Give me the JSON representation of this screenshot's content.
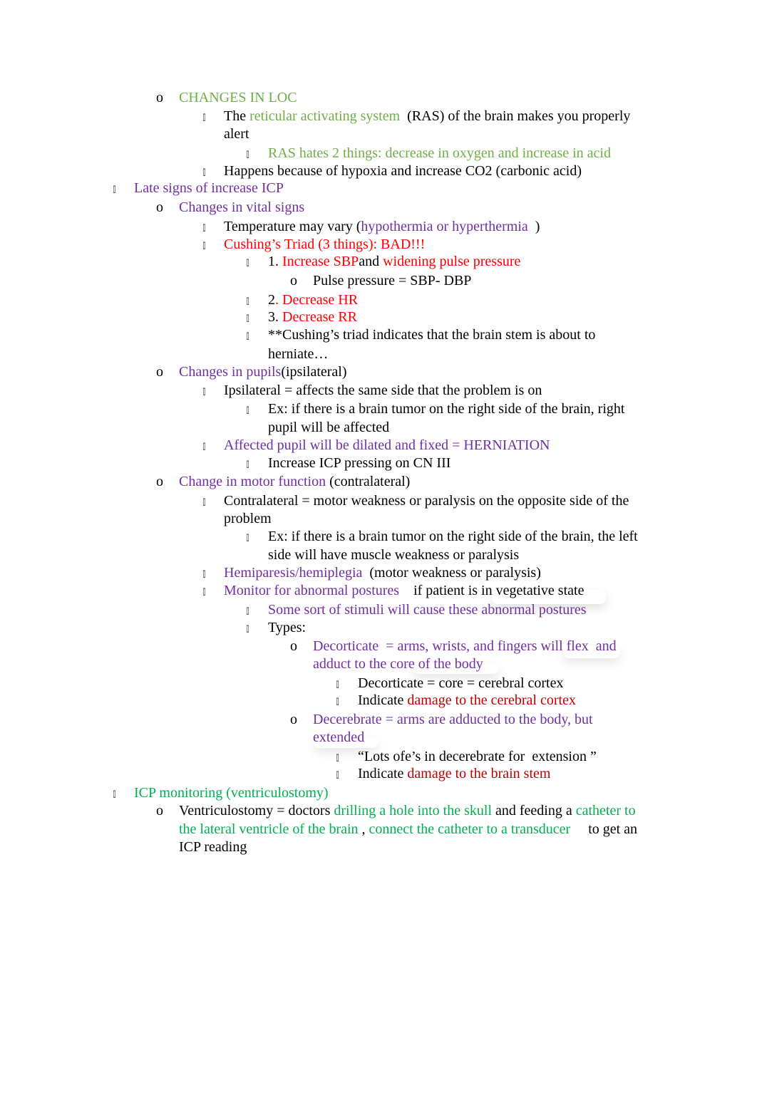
{
  "bullets": {
    "o": "o",
    "square": ""
  },
  "colors": {
    "light_green": "#70AD47",
    "purple": "#7030A0",
    "red": "#FF0000",
    "dark_red": "#C00000",
    "green": "#00B050",
    "black": "#000000"
  },
  "lines": [
    {
      "segs": [
        {
          "t": "CHANGES IN LOC",
          "c": "g1"
        }
      ]
    },
    {
      "segs": [
        {
          "t": "The ",
          "c": "k"
        },
        {
          "t": "reticular activating system",
          "c": "g1"
        },
        {
          "t": "  (RAS) of the brain makes you properly",
          "c": "k"
        }
      ]
    },
    {
      "segs": [
        {
          "t": "alert",
          "c": "k"
        }
      ]
    },
    {
      "segs": [
        {
          "t": "RAS hates 2 things: decrease in oxygen and increase in acid",
          "c": "g1"
        }
      ]
    },
    {
      "segs": [
        {
          "t": "Happens because of hypoxia and increase CO2 (carbonic acid)",
          "c": "k"
        }
      ]
    },
    {
      "segs": [
        {
          "t": "Late signs of increase ICP",
          "c": "pu"
        }
      ]
    },
    {
      "segs": [
        {
          "t": "Changes in vital signs",
          "c": "pu"
        }
      ]
    },
    {
      "segs": [
        {
          "t": "Temperature may vary (",
          "c": "k"
        },
        {
          "t": "hypothermia or hyperthermia",
          "c": "pu"
        },
        {
          "t": "  )",
          "c": "k"
        }
      ]
    },
    {
      "segs": [
        {
          "t": "Cushing’s Triad (3 things): BAD!!!",
          "c": "rd"
        }
      ]
    },
    {
      "segs": [
        {
          "t": "1. ",
          "c": "k"
        },
        {
          "t": "Increase SBP",
          "c": "rd"
        },
        {
          "t": "and ",
          "c": "k"
        },
        {
          "t": "widening pulse pressure",
          "c": "rd"
        }
      ]
    },
    {
      "segs": [
        {
          "t": "Pulse pressure = SBP- DBP",
          "c": "k"
        }
      ]
    },
    {
      "segs": [
        {
          "t": "2",
          "c": "k"
        },
        {
          "t": ". Decrease HR",
          "c": "rd"
        }
      ]
    },
    {
      "segs": [
        {
          "t": "3. ",
          "c": "k"
        },
        {
          "t": "Decrease RR",
          "c": "rd"
        }
      ]
    },
    {
      "segs": [
        {
          "t": "**Cushing’s triad indicates that the brain stem is about to",
          "c": "k"
        }
      ]
    },
    {
      "segs": [
        {
          "t": "herniate…",
          "c": "k"
        }
      ]
    },
    {
      "segs": [
        {
          "t": "Changes in pupils",
          "c": "pu"
        },
        {
          "t": "(ipsilateral)",
          "c": "k"
        }
      ]
    },
    {
      "segs": [
        {
          "t": "Ipsilateral = affects the same side that the problem is on",
          "c": "k"
        }
      ]
    },
    {
      "segs": [
        {
          "t": "Ex: if there is a brain tumor on the right side of the brain, right",
          "c": "k"
        }
      ]
    },
    {
      "segs": [
        {
          "t": "pupil will be affected",
          "c": "k"
        }
      ]
    },
    {
      "segs": [
        {
          "t": "Affected pupil will be dilated and fixed = HERNIATION",
          "c": "pu"
        }
      ]
    },
    {
      "segs": [
        {
          "t": "Increase ICP pressing on CN III",
          "c": "k"
        }
      ]
    },
    {
      "segs": [
        {
          "t": "Change in motor function",
          "c": "pu"
        },
        {
          "t": " (contralateral)",
          "c": "k"
        }
      ]
    },
    {
      "segs": [
        {
          "t": "Contralateral = motor weakness or paralysis on the opposite side of the",
          "c": "k"
        }
      ]
    },
    {
      "segs": [
        {
          "t": "problem",
          "c": "k"
        }
      ]
    },
    {
      "segs": [
        {
          "t": "Ex: if there is a brain tumor on the right side of the brain, the left",
          "c": "k"
        }
      ]
    },
    {
      "segs": [
        {
          "t": "side will have muscle weakness or paralysis",
          "c": "k"
        }
      ]
    },
    {
      "segs": [
        {
          "t": "Hemiparesis/hemiplegia",
          "c": "pu"
        },
        {
          "t": "  (motor weakness or paralysis)",
          "c": "k"
        }
      ]
    },
    {
      "segs": [
        {
          "t": "Monitor for abnormal postures",
          "c": "pu"
        },
        {
          "t": "    if patient is in vegetative state",
          "c": "k"
        }
      ]
    },
    {
      "segs": [
        {
          "t": "Some sort of stimuli will cause these abnormal postures",
          "c": "pu"
        }
      ]
    },
    {
      "segs": [
        {
          "t": "Types:",
          "c": "k"
        }
      ]
    },
    {
      "segs": [
        {
          "t": "Decorticate  = arms, wrists, and fingers will flex  and",
          "c": "pu"
        }
      ]
    },
    {
      "segs": [
        {
          "t": "adduct to the core of the body",
          "c": "pu"
        }
      ]
    },
    {
      "segs": [
        {
          "t": "Decorticate = core = cerebral cortex",
          "c": "k"
        }
      ]
    },
    {
      "segs": [
        {
          "t": "Indicate ",
          "c": "k"
        },
        {
          "t": "damage to the cerebral cortex",
          "c": "dr"
        }
      ]
    },
    {
      "segs": [
        {
          "t": "Decerebrate = arms are adducted to the body, but",
          "c": "pu"
        }
      ]
    },
    {
      "segs": [
        {
          "t": "extended",
          "c": "pu"
        }
      ]
    },
    {
      "segs": [
        {
          "t": "“Lots of",
          "c": "k"
        },
        {
          "t": "e’s in decerebrate for  extension ”",
          "c": "k"
        }
      ]
    },
    {
      "segs": [
        {
          "t": "Indicate ",
          "c": "k"
        },
        {
          "t": "damage to the brain stem",
          "c": "dr"
        }
      ]
    },
    {
      "segs": [
        {
          "t": "ICP monitoring (ventriculostomy)",
          "c": "g2"
        }
      ]
    },
    {
      "segs": [
        {
          "t": "Ventriculostomy = doctors ",
          "c": "k"
        },
        {
          "t": "drilling a hole into the skull",
          "c": "g2"
        },
        {
          "t": " and feeding a ",
          "c": "k"
        },
        {
          "t": "catheter to",
          "c": "g2"
        }
      ]
    },
    {
      "segs": [
        {
          "t": "the lateral ventricle of the brain",
          "c": "g2"
        },
        {
          "t": " , ",
          "c": "k"
        },
        {
          "t": "connect the catheter to a transducer",
          "c": "g2"
        },
        {
          "t": "     to get an",
          "c": "k"
        }
      ]
    },
    {
      "segs": [
        {
          "t": "ICP reading",
          "c": "k"
        }
      ]
    }
  ]
}
